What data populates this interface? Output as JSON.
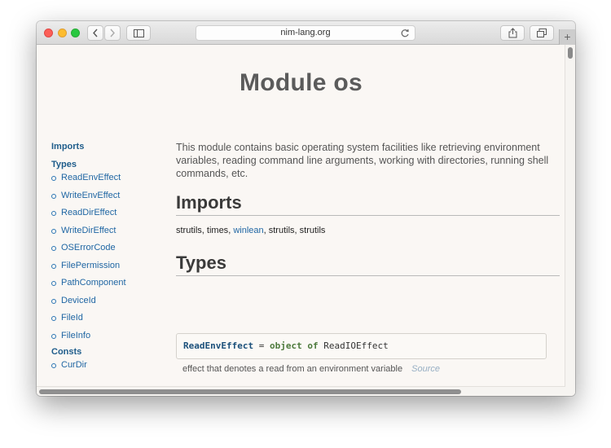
{
  "browser": {
    "url": "nim-lang.org",
    "new_tab": "+"
  },
  "page": {
    "title": "Module os"
  },
  "sidebar": {
    "imports_label": "Imports",
    "types_label": "Types",
    "types": [
      "ReadEnvEffect",
      "WriteEnvEffect",
      "ReadDirEffect",
      "WriteDirEffect",
      "OSErrorCode",
      "FilePermission",
      "PathComponent",
      "DeviceId",
      "FileId",
      "FileInfo"
    ],
    "consts_label": "Consts",
    "consts": [
      "CurDir"
    ]
  },
  "main": {
    "intro": "This module contains basic operating system facilities like retrieving environment variables, reading command line arguments, working with directories, running shell commands, etc.",
    "imports_heading": "Imports",
    "imports": [
      {
        "name": "strutils",
        "link": false
      },
      {
        "name": "times",
        "link": false
      },
      {
        "name": "winlean",
        "link": true
      },
      {
        "name": "strutils",
        "link": false
      },
      {
        "name": "strutils",
        "link": false
      }
    ],
    "types_heading": "Types",
    "first_type": {
      "name": "ReadEnvEffect",
      "eq": "=",
      "kw_object": "object",
      "kw_of": "of",
      "base": "ReadIOEffect",
      "description": "effect that denotes a read from an environment variable",
      "source_label": "Source"
    }
  },
  "colors": {
    "page_background": "#faf7f4",
    "link": "#1f66a3",
    "keyword": "#4d7a3c",
    "title": "#5b5b5b"
  },
  "icons": [
    "back-chevron-icon",
    "forward-chevron-icon",
    "sidebar-toggle-icon",
    "reload-icon",
    "share-icon",
    "tabs-overview-icon"
  ]
}
